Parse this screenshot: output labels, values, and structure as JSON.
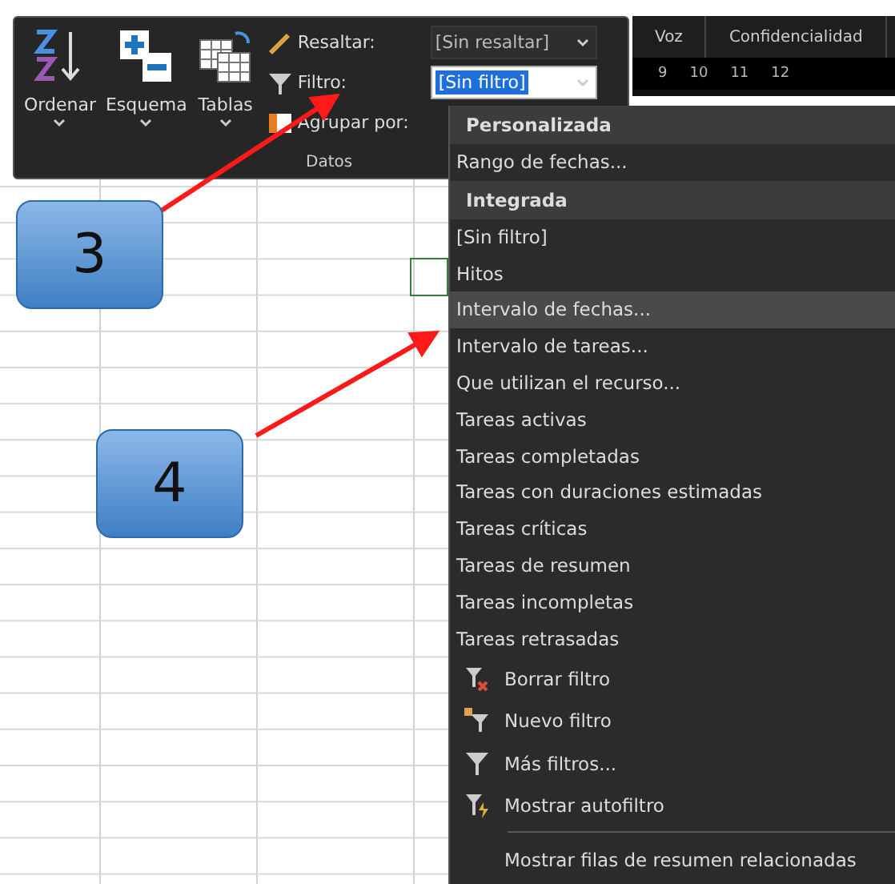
{
  "ribbon": {
    "buttons": [
      {
        "label": "Ordenar"
      },
      {
        "label": "Esquema"
      },
      {
        "label": "Tablas"
      }
    ],
    "fields": [
      {
        "label": "Resaltar:",
        "value": "[Sin resaltar]",
        "focused": false
      },
      {
        "label": "Filtro:",
        "value": "[Sin filtro]",
        "focused": true
      },
      {
        "label": "Agrupar por:"
      }
    ],
    "group_label": "Datos"
  },
  "view_tabs": [
    "Voz",
    "Confidencialidad"
  ],
  "timescale": [
    "9",
    "10",
    "11",
    "12"
  ],
  "menu": [
    {
      "kind": "heading",
      "label": "Personalizada"
    },
    {
      "kind": "item",
      "label": "Rango de fechas...",
      "selected": false
    },
    {
      "kind": "heading",
      "label": "Integrada"
    },
    {
      "kind": "item",
      "label": "[Sin filtro]",
      "selected": false
    },
    {
      "kind": "item",
      "label": "Hitos",
      "selected": false
    },
    {
      "kind": "item",
      "label": "Intervalo de fechas...",
      "selected": true
    },
    {
      "kind": "item",
      "label": "Intervalo de tareas...",
      "selected": false
    },
    {
      "kind": "item",
      "label": "Que utilizan el recurso...",
      "selected": false
    },
    {
      "kind": "item",
      "label": "Tareas activas",
      "selected": false
    },
    {
      "kind": "item",
      "label": "Tareas completadas",
      "selected": false
    },
    {
      "kind": "item",
      "label": "Tareas con duraciones estimadas",
      "selected": false
    },
    {
      "kind": "item",
      "label": "Tareas críticas",
      "selected": false
    },
    {
      "kind": "item",
      "label": "Tareas de resumen",
      "selected": false
    },
    {
      "kind": "item",
      "label": "Tareas incompletas",
      "selected": false
    },
    {
      "kind": "item",
      "label": "Tareas retrasadas",
      "selected": false
    },
    {
      "kind": "command",
      "label": "Borrar filtro"
    },
    {
      "kind": "command",
      "label": "Nuevo filtro"
    },
    {
      "kind": "command",
      "label": "Más filtros..."
    },
    {
      "kind": "command",
      "label": "Mostrar autofiltro"
    },
    {
      "kind": "separator"
    },
    {
      "kind": "command",
      "label": "Mostrar filas de resumen relacionadas"
    }
  ],
  "callouts": [
    "3",
    "4"
  ]
}
